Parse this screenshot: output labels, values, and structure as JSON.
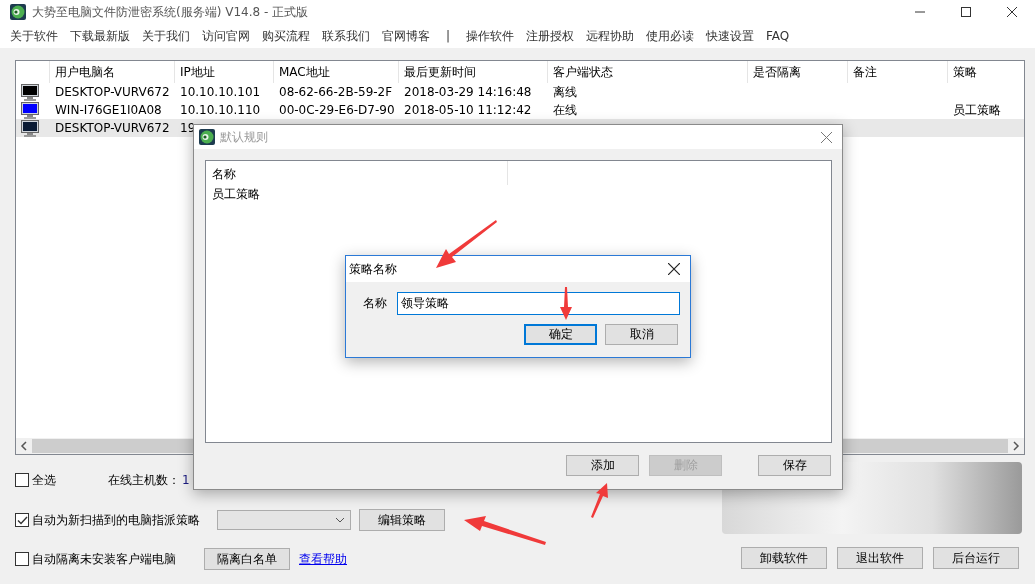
{
  "window": {
    "title": "大势至电脑文件防泄密系统(服务端) V14.8 - 正式版"
  },
  "menu": {
    "items_left": [
      "关于软件",
      "下载最新版",
      "关于我们",
      "访问官网",
      "购买流程",
      "联系我们",
      "官网博客"
    ],
    "separator": "|",
    "items_right": [
      "操作软件",
      "注册授权",
      "远程协助",
      "使用必读",
      "快速设置",
      "FAQ"
    ]
  },
  "table": {
    "columns": [
      "用户电脑名",
      "IP地址",
      "MAC地址",
      "最后更新时间",
      "客户端状态",
      "是否隔离",
      "备注",
      "策略"
    ],
    "rows": [
      {
        "color": "#000000",
        "selected": false,
        "cells": [
          "DESKTOP-VURV672",
          "10.10.10.101",
          "08-62-66-2B-59-2F",
          "2018-03-29 14:16:48",
          "离线",
          "",
          "",
          ""
        ]
      },
      {
        "color": "#0000ff",
        "selected": false,
        "cells": [
          "WIN-I76GE1I0A08",
          "10.10.10.110",
          "00-0C-29-E6-D7-90",
          "2018-05-10 11:12:42",
          "在线",
          "",
          "",
          "员工策略"
        ]
      },
      {
        "color": "#0a1a33",
        "selected": true,
        "cells": [
          "DESKTOP-VURV672",
          "19"
        ]
      }
    ]
  },
  "select_all": {
    "label": "全选",
    "checked": false
  },
  "online_count": {
    "label": "在线主机数：",
    "value": "1"
  },
  "auto_assign": {
    "label": "自动为新扫描到的电脑指派策略",
    "checked": true
  },
  "edit_policy_button": "编辑策略",
  "auto_isolate": {
    "label": "自动隔离未安装客户端电脑",
    "checked": false
  },
  "whitelist_button": "隔离白名单",
  "help_link": "查看帮助",
  "bottom_buttons": [
    "卸载软件",
    "退出软件",
    "后台运行"
  ],
  "rules_dialog": {
    "title": "默认规则",
    "columns": [
      "名称"
    ],
    "rows": [
      "员工策略"
    ],
    "buttons": [
      {
        "label": "添加",
        "disabled": false
      },
      {
        "label": "删除",
        "disabled": true
      },
      {
        "label": "保存",
        "disabled": false
      }
    ]
  },
  "name_dialog": {
    "title": "策略名称",
    "field_label": "名称",
    "value": "领导策略",
    "buttons": [
      {
        "label": "确定",
        "default": true
      },
      {
        "label": "取消",
        "default": false
      }
    ]
  }
}
